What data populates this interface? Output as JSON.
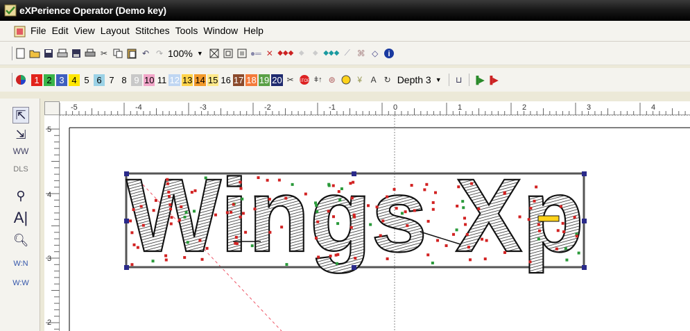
{
  "window": {
    "title": "eXPerience Operator (Demo key)"
  },
  "menu": {
    "items": [
      "File",
      "Edit",
      "View",
      "Layout",
      "Stitches",
      "Tools",
      "Window",
      "Help"
    ]
  },
  "toolbar": {
    "zoom": "100%",
    "depth_label": "Depth 3"
  },
  "color_chips": [
    {
      "label": "1",
      "color": "#e2231a",
      "light": true
    },
    {
      "label": "2",
      "color": "#3ab54a",
      "light": false
    },
    {
      "label": "3",
      "color": "#3f5fbf",
      "light": true
    },
    {
      "label": "4",
      "color": "#ffe600",
      "light": false
    },
    {
      "label": "5",
      "color": "#f4f3ee",
      "light": false
    },
    {
      "label": "6",
      "color": "#9bd2e6",
      "light": false
    },
    {
      "label": "7",
      "color": "#f4f3ee",
      "light": false
    },
    {
      "label": "8",
      "color": "#f4f3ee",
      "light": false
    },
    {
      "label": "9",
      "color": "#c8c8c8",
      "light": true
    },
    {
      "label": "10",
      "color": "#f2a5c8",
      "light": false
    },
    {
      "label": "11",
      "color": "#f4f3ee",
      "light": false
    },
    {
      "label": "12",
      "color": "#bfd6f2",
      "light": true
    },
    {
      "label": "13",
      "color": "#ffd34a",
      "light": false
    },
    {
      "label": "14",
      "color": "#f39a2b",
      "light": false
    },
    {
      "label": "15",
      "color": "#ffe98a",
      "light": false
    },
    {
      "label": "16",
      "color": "#f4f3ee",
      "light": false
    },
    {
      "label": "17",
      "color": "#8b4a2b",
      "light": true
    },
    {
      "label": "18",
      "color": "#f47a3a",
      "light": true
    },
    {
      "label": "19",
      "color": "#5aa045",
      "light": true
    },
    {
      "label": "20",
      "color": "#1f2a6e",
      "light": true
    }
  ],
  "ruler": {
    "h_labels": [
      "-5",
      "-4",
      "-3",
      "-2",
      "-1",
      "0",
      "1",
      "2",
      "3",
      "4"
    ],
    "v_labels": [
      "5",
      "4",
      "3",
      "2"
    ]
  },
  "design": {
    "text": "Wings Xp"
  },
  "icons": {
    "app": "app-icon",
    "document": "document-icon"
  }
}
